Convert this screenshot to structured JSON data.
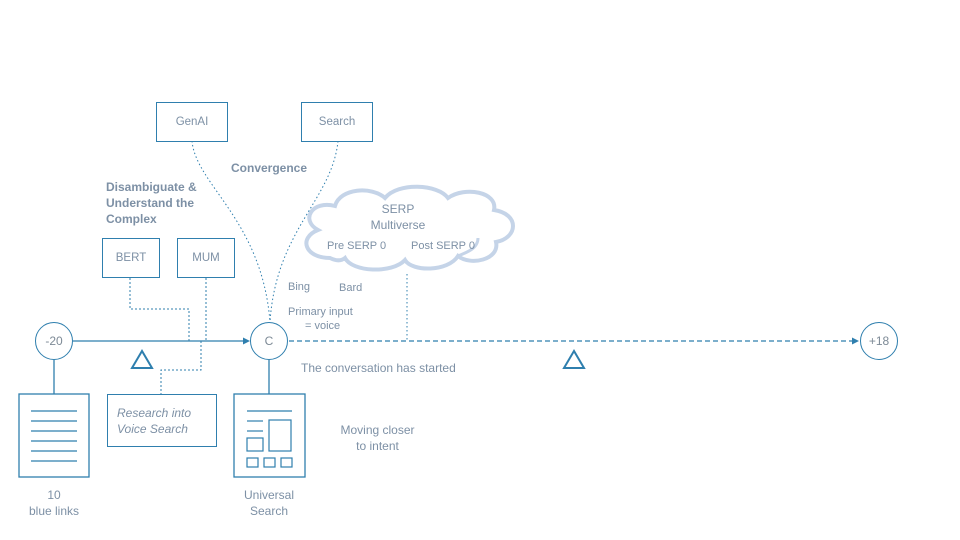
{
  "colors": {
    "line": "#2f7fae",
    "text": "#7d90a5",
    "cloud": "#c5d4e8"
  },
  "boxes": {
    "genai": "GenAI",
    "search": "Search",
    "bert": "BERT",
    "mum": "MUM",
    "research": "Research into\nVoice Search"
  },
  "labels": {
    "convergence": "Convergence",
    "disambiguate": [
      "Disambiguate &",
      "Understand the",
      "Complex"
    ],
    "cloud_title": [
      "SERP",
      "Multiverse"
    ],
    "pre_serp": "Pre SERP 0",
    "post_serp": "Post SERP 0",
    "bing": "Bing",
    "bard": "Bard",
    "primary_input": [
      "Primary input",
      "= voice"
    ],
    "conversation": "The conversation has started",
    "moving_closer": [
      "Moving closer",
      "to intent"
    ],
    "ten_blue_links": [
      "10",
      "blue links"
    ],
    "universal_search": [
      "Universal",
      "Search"
    ]
  },
  "timeline": {
    "start": "-20",
    "center": "C",
    "end": "+18"
  },
  "icons": {
    "document": "document-lines-icon",
    "layout": "universal-search-layout-icon",
    "triangle": "triangle-icon",
    "cloud": "cloud-shape"
  }
}
